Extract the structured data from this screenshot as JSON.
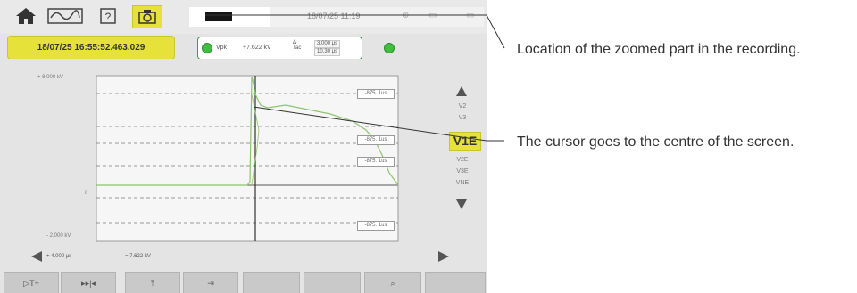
{
  "toolbar": {
    "icons": [
      "home-icon",
      "waveform-mode-icon",
      "help-icon",
      "camera-icon"
    ],
    "selected": "camera-icon"
  },
  "status_bar": {
    "datetime": "18/07/25 11:19",
    "zoom_location_marker": "zoom-location-indicator"
  },
  "recording": {
    "timestamp": "18/07/25 16:55:52.463.029"
  },
  "measurement": {
    "param": "Vpk",
    "value": "+7.622 kV",
    "delta_symbol": "Δ\nTac",
    "time_base_1": "3.000 μs",
    "time_base_2": "10.30 μs"
  },
  "plot": {
    "y_top_label": "+ 8.000 kV",
    "y_zero_label": "0",
    "y_bottom_label": "- 2.000 kV",
    "right_labels": [
      "-875. 1us",
      "-875. 1us",
      "-875. 1us",
      "-875. 1us"
    ],
    "trace_color": "#8cc46d",
    "cursor_color": "#333333"
  },
  "channels": {
    "up_labels": [
      "V2",
      "V3"
    ],
    "selected": "V1E",
    "down_labels": [
      "V2E",
      "V3E",
      "VNE"
    ]
  },
  "bottom_info": {
    "time": "+ 4.000 μs",
    "value": "= 7.622 kV"
  },
  "function_keys": [
    "▷T+",
    "▸▸|◂",
    "⤒",
    "⇥",
    "",
    "",
    "⌕",
    ""
  ],
  "callouts": [
    {
      "text": "Location of the zoomed part in the recording."
    },
    {
      "text": "The cursor goes to the centre of the screen."
    }
  ],
  "colors": {
    "accent_yellow": "#e6e23a",
    "green_indicator": "#3fbe3f",
    "screen_bg": "#e4e4e4"
  }
}
